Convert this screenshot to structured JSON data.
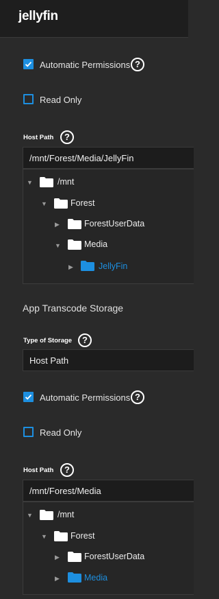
{
  "header": {
    "title": "jellyfin"
  },
  "storage1": {
    "auto_permissions": {
      "label": "Automatic Permissions",
      "checked": true
    },
    "read_only": {
      "label": "Read Only",
      "checked": false
    },
    "host_path_label": "Host Path",
    "host_path_value": "/mnt/Forest/Media/JellyFin",
    "tree": [
      {
        "label": "/mnt",
        "expanded": true
      },
      {
        "label": "Forest",
        "expanded": true
      },
      {
        "label": "ForestUserData",
        "expanded": false
      },
      {
        "label": "Media",
        "expanded": true
      },
      {
        "label": "JellyFin",
        "expanded": false,
        "selected": true
      }
    ]
  },
  "transcode": {
    "section_title": "App Transcode Storage",
    "type_label": "Type of Storage",
    "type_value": "Host Path",
    "auto_permissions": {
      "label": "Automatic Permissions",
      "checked": true
    },
    "read_only": {
      "label": "Read Only",
      "checked": false
    },
    "host_path_label": "Host Path",
    "host_path_value": "/mnt/Forest/Media",
    "tree": [
      {
        "label": "/mnt",
        "expanded": true
      },
      {
        "label": "Forest",
        "expanded": true
      },
      {
        "label": "ForestUserData",
        "expanded": false
      },
      {
        "label": "Media",
        "expanded": false,
        "selected": true
      }
    ]
  },
  "colors": {
    "accent": "#1d8fe0",
    "background": "#2a2a2a",
    "header": "#1e1e1e",
    "input": "#1c1c1c"
  },
  "icons": {
    "help": "?",
    "folder": "folder-icon",
    "collapsed": "▶",
    "expanded": "▼"
  }
}
